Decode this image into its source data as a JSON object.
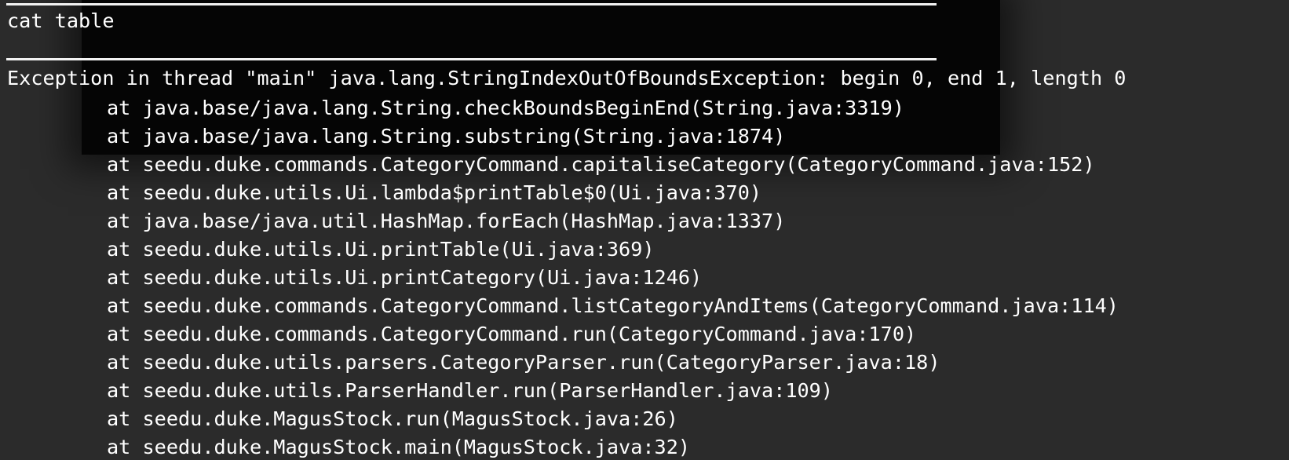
{
  "terminal": {
    "command": "cat table",
    "exception": "Exception in thread \"main\" java.lang.StringIndexOutOfBoundsException: begin 0, end 1, length 0",
    "stack_trace": [
      "at java.base/java.lang.String.checkBoundsBeginEnd(String.java:3319)",
      "at java.base/java.lang.String.substring(String.java:1874)",
      "at seedu.duke.commands.CategoryCommand.capitaliseCategory(CategoryCommand.java:152)",
      "at seedu.duke.utils.Ui.lambda$printTable$0(Ui.java:370)",
      "at java.base/java.util.HashMap.forEach(HashMap.java:1337)",
      "at seedu.duke.utils.Ui.printTable(Ui.java:369)",
      "at seedu.duke.utils.Ui.printCategory(Ui.java:1246)",
      "at seedu.duke.commands.CategoryCommand.listCategoryAndItems(CategoryCommand.java:114)",
      "at seedu.duke.commands.CategoryCommand.run(CategoryCommand.java:170)",
      "at seedu.duke.utils.parsers.CategoryParser.run(CategoryParser.java:18)",
      "at seedu.duke.utils.ParserHandler.run(ParserHandler.java:109)",
      "at seedu.duke.MagusStock.run(MagusStock.java:26)",
      "at seedu.duke.MagusStock.main(MagusStock.java:32)"
    ]
  },
  "colors": {
    "background": "#2b2b2b",
    "text": "#ffffff",
    "rule": "#f2f2f2"
  }
}
